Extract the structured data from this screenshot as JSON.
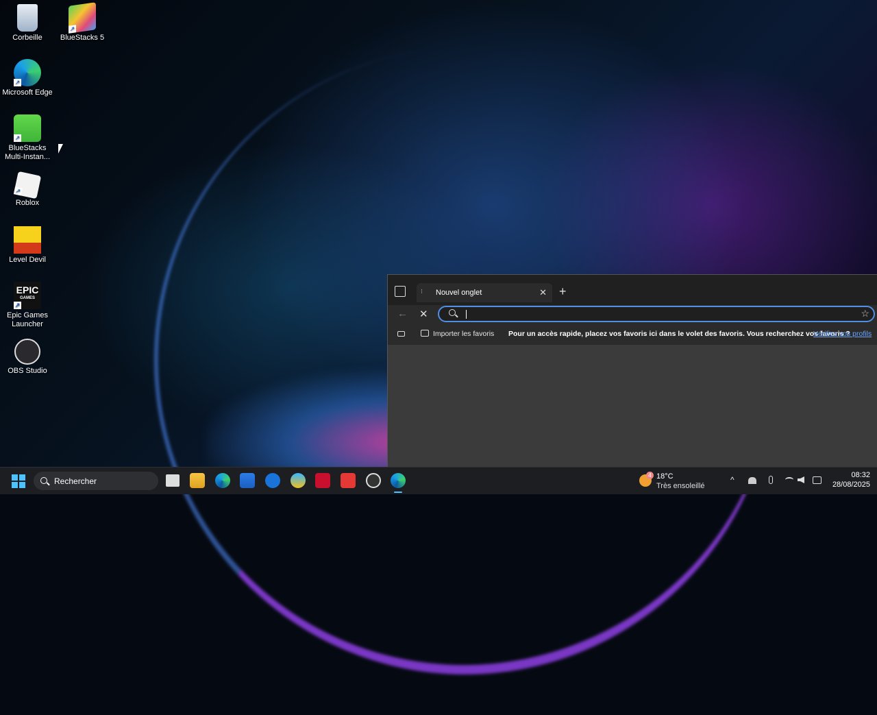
{
  "desktop": {
    "icons": [
      {
        "label_line1": "Corbeille",
        "label_line2": "",
        "icon": "recycle-bin-icon"
      },
      {
        "label_line1": "BlueStacks 5",
        "label_line2": "",
        "icon": "bluestacks-icon"
      },
      {
        "label_line1": "Microsoft Edge",
        "label_line2": "",
        "icon": "edge-icon"
      },
      {
        "label_line1": "BlueStacks",
        "label_line2": "Multi-Instan...",
        "icon": "bluestacks-multi-icon"
      },
      {
        "label_line1": "Roblox",
        "label_line2": "",
        "icon": "roblox-icon"
      },
      {
        "label_line1": "Level Devil",
        "label_line2": "",
        "icon": "level-devil-icon"
      },
      {
        "label_line1": "Epic Games",
        "label_line2": "Launcher",
        "icon": "epic-games-icon"
      },
      {
        "label_line1": "OBS Studio",
        "label_line2": "",
        "icon": "obs-icon"
      }
    ],
    "shortcut_arrow": "↗",
    "epic_logo_text": "EPIC",
    "epic_logo_sub": "GAMES"
  },
  "browser": {
    "tab_title": "Nouvel onglet",
    "tab_close": "✕",
    "new_tab": "+",
    "back": "←",
    "stop": "✕",
    "star": "☆",
    "favbar": {
      "import_label": "Importer les favoris",
      "message": "Pour un accès rapide, placez vos favoris ici dans le volet des favoris. Vous recherchez vos favoris ?",
      "link": "Vérifiez vos profils"
    }
  },
  "taskbar": {
    "search_label": "Rechercher",
    "weather": {
      "temp": "18°C",
      "condition": "Très ensoleillé",
      "badge": "4"
    },
    "tray": {
      "chevron": "^"
    },
    "clock": {
      "time": "08:32",
      "date": "28/08/2025"
    },
    "colors": {
      "start": "#4cc2ff",
      "accent": "#4cc2ff"
    }
  }
}
